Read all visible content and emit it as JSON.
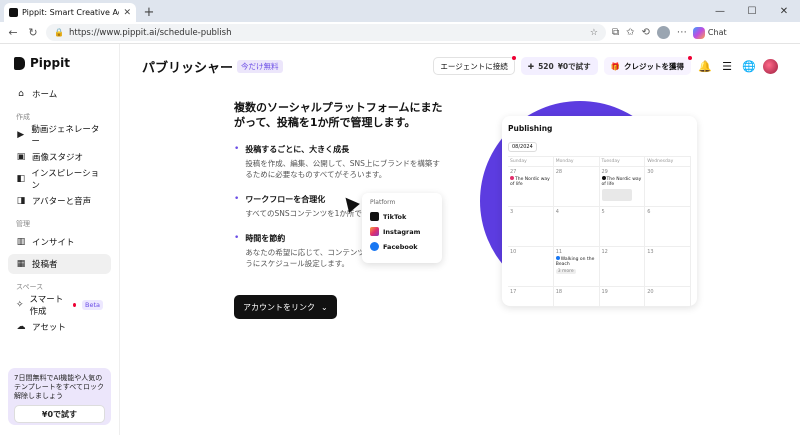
{
  "browser": {
    "tab_title": "Pippit: Smart Creative Agent for Sc",
    "url": "https://www.pippit.ai/schedule-publish",
    "copilot_label": "Chat"
  },
  "sidebar": {
    "logo": "Pippit",
    "home": "ホーム",
    "section_create": "作成",
    "create_items": [
      "動画ジェネレーター",
      "画像スタジオ",
      "インスピレーション",
      "アバターと音声"
    ],
    "section_manage": "管理",
    "manage_items": [
      "インサイト",
      "投稿者"
    ],
    "section_space": "スペース",
    "smart_create": "スマート作成",
    "beta": "Beta",
    "asset": "アセット",
    "promo_text": "7日間無料でAI機能や人気のテンプレートをすべてロック解除しましょう",
    "promo_button": "¥0で試す"
  },
  "header": {
    "title": "パブリッシャー",
    "badge": "今だけ無料",
    "agent_connect": "エージェントに接続",
    "credits": "520",
    "try_free": "¥0で試す",
    "get_credits": "クレジットを獲得"
  },
  "main": {
    "headline": "複数のソーシャルプラットフォームにまたがって、投稿を1か所で管理します。",
    "features": [
      {
        "title": "投稿するごとに、大きく成長",
        "desc": "投稿を作成、編集、公開して、SNS上にブランドを構築するために必要なものすべてがそろいます。"
      },
      {
        "title": "ワークフローを合理化",
        "desc": "すべてのSNSコンテンツを1か所で管理します。"
      },
      {
        "title": "時間を節約",
        "desc": "あなたの希望に応じて、コンテンツを自動的に投稿するようにスケジュール設定します。"
      }
    ],
    "cta": "アカウントをリンク"
  },
  "illustration": {
    "title": "Publishing",
    "date": "08/2024",
    "weekdays": [
      "Sunday",
      "Monday",
      "Tuesday",
      "Wednesday"
    ],
    "days": [
      "27",
      "28",
      "29",
      "30",
      "3",
      "4",
      "5",
      "6",
      "10",
      "11",
      "12",
      "13",
      "17",
      "18",
      "19",
      "20"
    ],
    "events": {
      "e1": "The Nordic way of life",
      "e2": "The Nordic way of life",
      "e3": "Walking on the Beach",
      "more": "3 more"
    },
    "platform_title": "Platform",
    "platforms": [
      "TikTok",
      "Instagram",
      "Facebook"
    ],
    "colors": {
      "accent": "#5c3ce0",
      "tiktok": "#111111",
      "instagram": "#e1306c",
      "facebook": "#1877f2"
    }
  }
}
